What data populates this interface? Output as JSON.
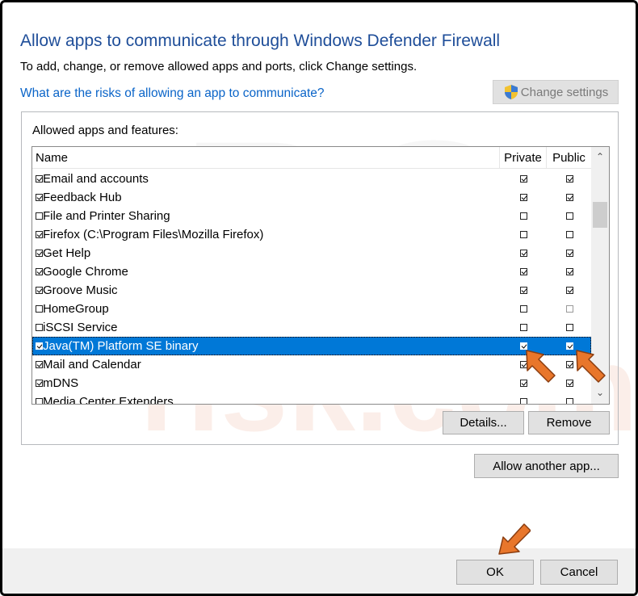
{
  "dialog": {
    "title": "Allow apps to communicate through Windows Defender Firewall",
    "subtitle": "To add, change, or remove allowed apps and ports, click Change settings.",
    "risk_link": "What are the risks of allowing an app to communicate?",
    "change_settings_label": "Change settings"
  },
  "apps": {
    "group_label": "Allowed apps and features:",
    "columns": {
      "name": "Name",
      "private": "Private",
      "public": "Public"
    },
    "rows": [
      {
        "name": "Email and accounts",
        "enabled": true,
        "private": true,
        "public": true
      },
      {
        "name": "Feedback Hub",
        "enabled": true,
        "private": true,
        "public": true
      },
      {
        "name": "File and Printer Sharing",
        "enabled": false,
        "private": false,
        "public": false
      },
      {
        "name": "Firefox (C:\\Program Files\\Mozilla Firefox)",
        "enabled": true,
        "private": false,
        "public": false
      },
      {
        "name": "Get Help",
        "enabled": true,
        "private": true,
        "public": true
      },
      {
        "name": "Google Chrome",
        "enabled": true,
        "private": true,
        "public": true
      },
      {
        "name": "Groove Music",
        "enabled": true,
        "private": true,
        "public": true
      },
      {
        "name": "HomeGroup",
        "enabled": false,
        "private": false,
        "public": false
      },
      {
        "name": "iSCSI Service",
        "enabled": false,
        "private": false,
        "public": false
      },
      {
        "name": "Java(TM) Platform SE binary",
        "enabled": true,
        "private": true,
        "public": true,
        "selected": true
      },
      {
        "name": "Mail and Calendar",
        "enabled": true,
        "private": true,
        "public": true
      },
      {
        "name": "mDNS",
        "enabled": true,
        "private": true,
        "public": true
      },
      {
        "name": "Media Center Extenders",
        "enabled": false,
        "private": false,
        "public": false
      }
    ],
    "details_label": "Details...",
    "remove_label": "Remove",
    "allow_another_label": "Allow another app..."
  },
  "footer": {
    "ok_label": "OK",
    "cancel_label": "Cancel"
  },
  "colors": {
    "title": "#1f4e99",
    "link": "#0a64c8",
    "selection": "#0078d7",
    "arrow": "#e8762b"
  }
}
